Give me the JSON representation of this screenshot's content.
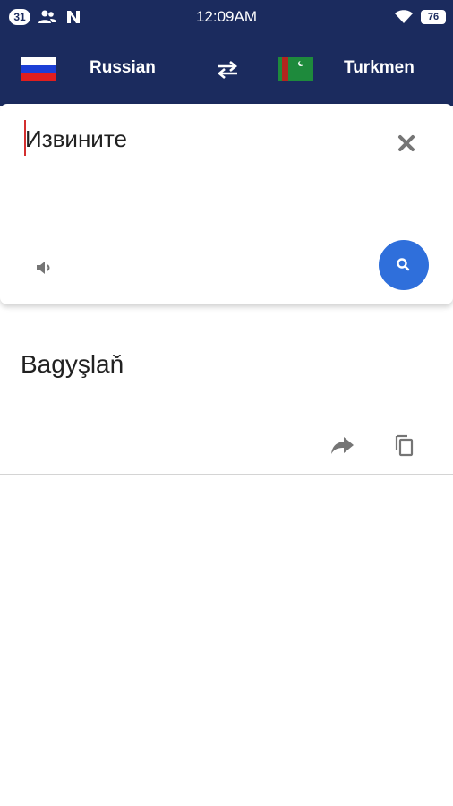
{
  "status_bar": {
    "notification_count": "31",
    "time": "12:09AM",
    "battery": "76",
    "icons": [
      "contacts-icon",
      "n-app-icon",
      "wifi-icon",
      "battery-icon"
    ]
  },
  "header": {
    "source_language": "Russian",
    "target_language": "Turkmen",
    "source_flag": "russia-flag-icon",
    "target_flag": "turkmenistan-flag-icon",
    "swap_icon": "swap-arrows-icon"
  },
  "input": {
    "text": "Извините",
    "clear_icon": "close-icon",
    "speaker_icon": "speaker-icon",
    "search_icon": "search-icon"
  },
  "result": {
    "text": "Bagyşlaň",
    "share_icon": "share-icon",
    "copy_icon": "copy-icon"
  },
  "colors": {
    "header_bg": "#1b2b5e",
    "accent_blue": "#2f6fdb",
    "cursor_red": "#d32f2f",
    "icon_gray": "#757575"
  }
}
